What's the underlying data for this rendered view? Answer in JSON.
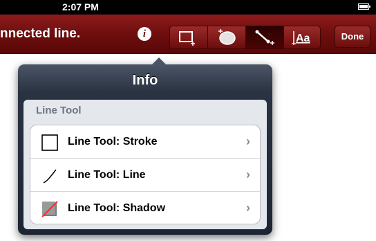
{
  "status": {
    "time": "2:07 PM"
  },
  "toolbar": {
    "title": "nnected line.",
    "tools": [
      {
        "icon": "rectangle-add-icon",
        "active": false
      },
      {
        "icon": "lasso-add-icon",
        "active": false
      },
      {
        "icon": "line-add-icon",
        "active": true
      },
      {
        "icon": "text-aa-icon",
        "label": "Aa",
        "active": false
      }
    ],
    "done_label": "Done"
  },
  "popover": {
    "title": "Info",
    "section": "Line Tool",
    "rows": [
      {
        "label": "Line Tool: Stroke",
        "icon": "stroke-square-icon"
      },
      {
        "label": "Line Tool: Line",
        "icon": "line-curve-icon"
      },
      {
        "label": "Line Tool: Shadow",
        "icon": "shadow-icon"
      }
    ]
  },
  "colors": {
    "toolbar": "#6e0e0e",
    "popover": "#1d2533",
    "shadow_slash": "#ff2a2a"
  }
}
